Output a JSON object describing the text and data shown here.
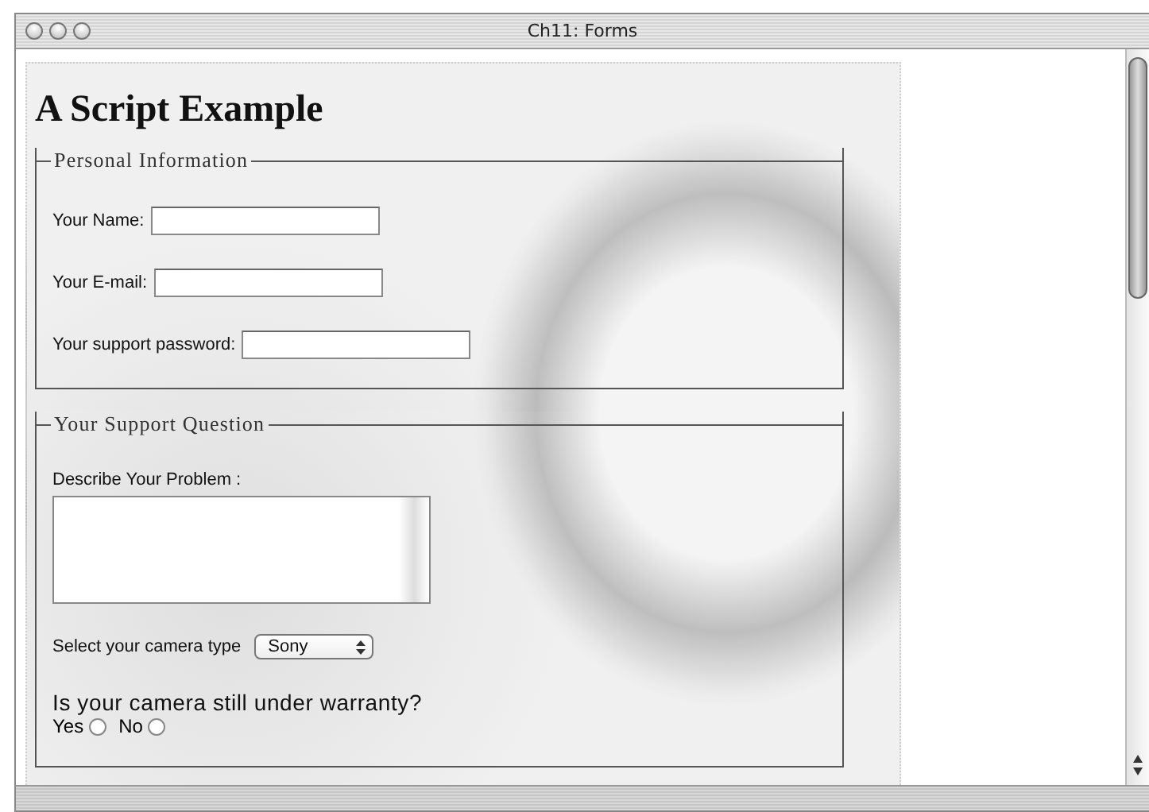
{
  "window": {
    "title": "Ch11: Forms"
  },
  "heading": "A Script Example",
  "fieldsets": [
    {
      "legend": "Personal Information",
      "fields": [
        {
          "kind": "text",
          "label": "Your Name:"
        },
        {
          "kind": "text",
          "label": "Your E-mail:"
        },
        {
          "kind": "password",
          "label": "Your support password:"
        }
      ]
    },
    {
      "legend": "Your Support Question",
      "fields": [
        {
          "kind": "textarea",
          "label": "Describe Your Problem :"
        },
        {
          "kind": "select",
          "label": "Select your camera type",
          "value": "Sony"
        },
        {
          "kind": "radio",
          "label": "Is your camera still under warranty?",
          "options": [
            {
              "label": "Yes",
              "selected": false
            },
            {
              "label": "No",
              "selected": false
            }
          ]
        }
      ]
    }
  ]
}
